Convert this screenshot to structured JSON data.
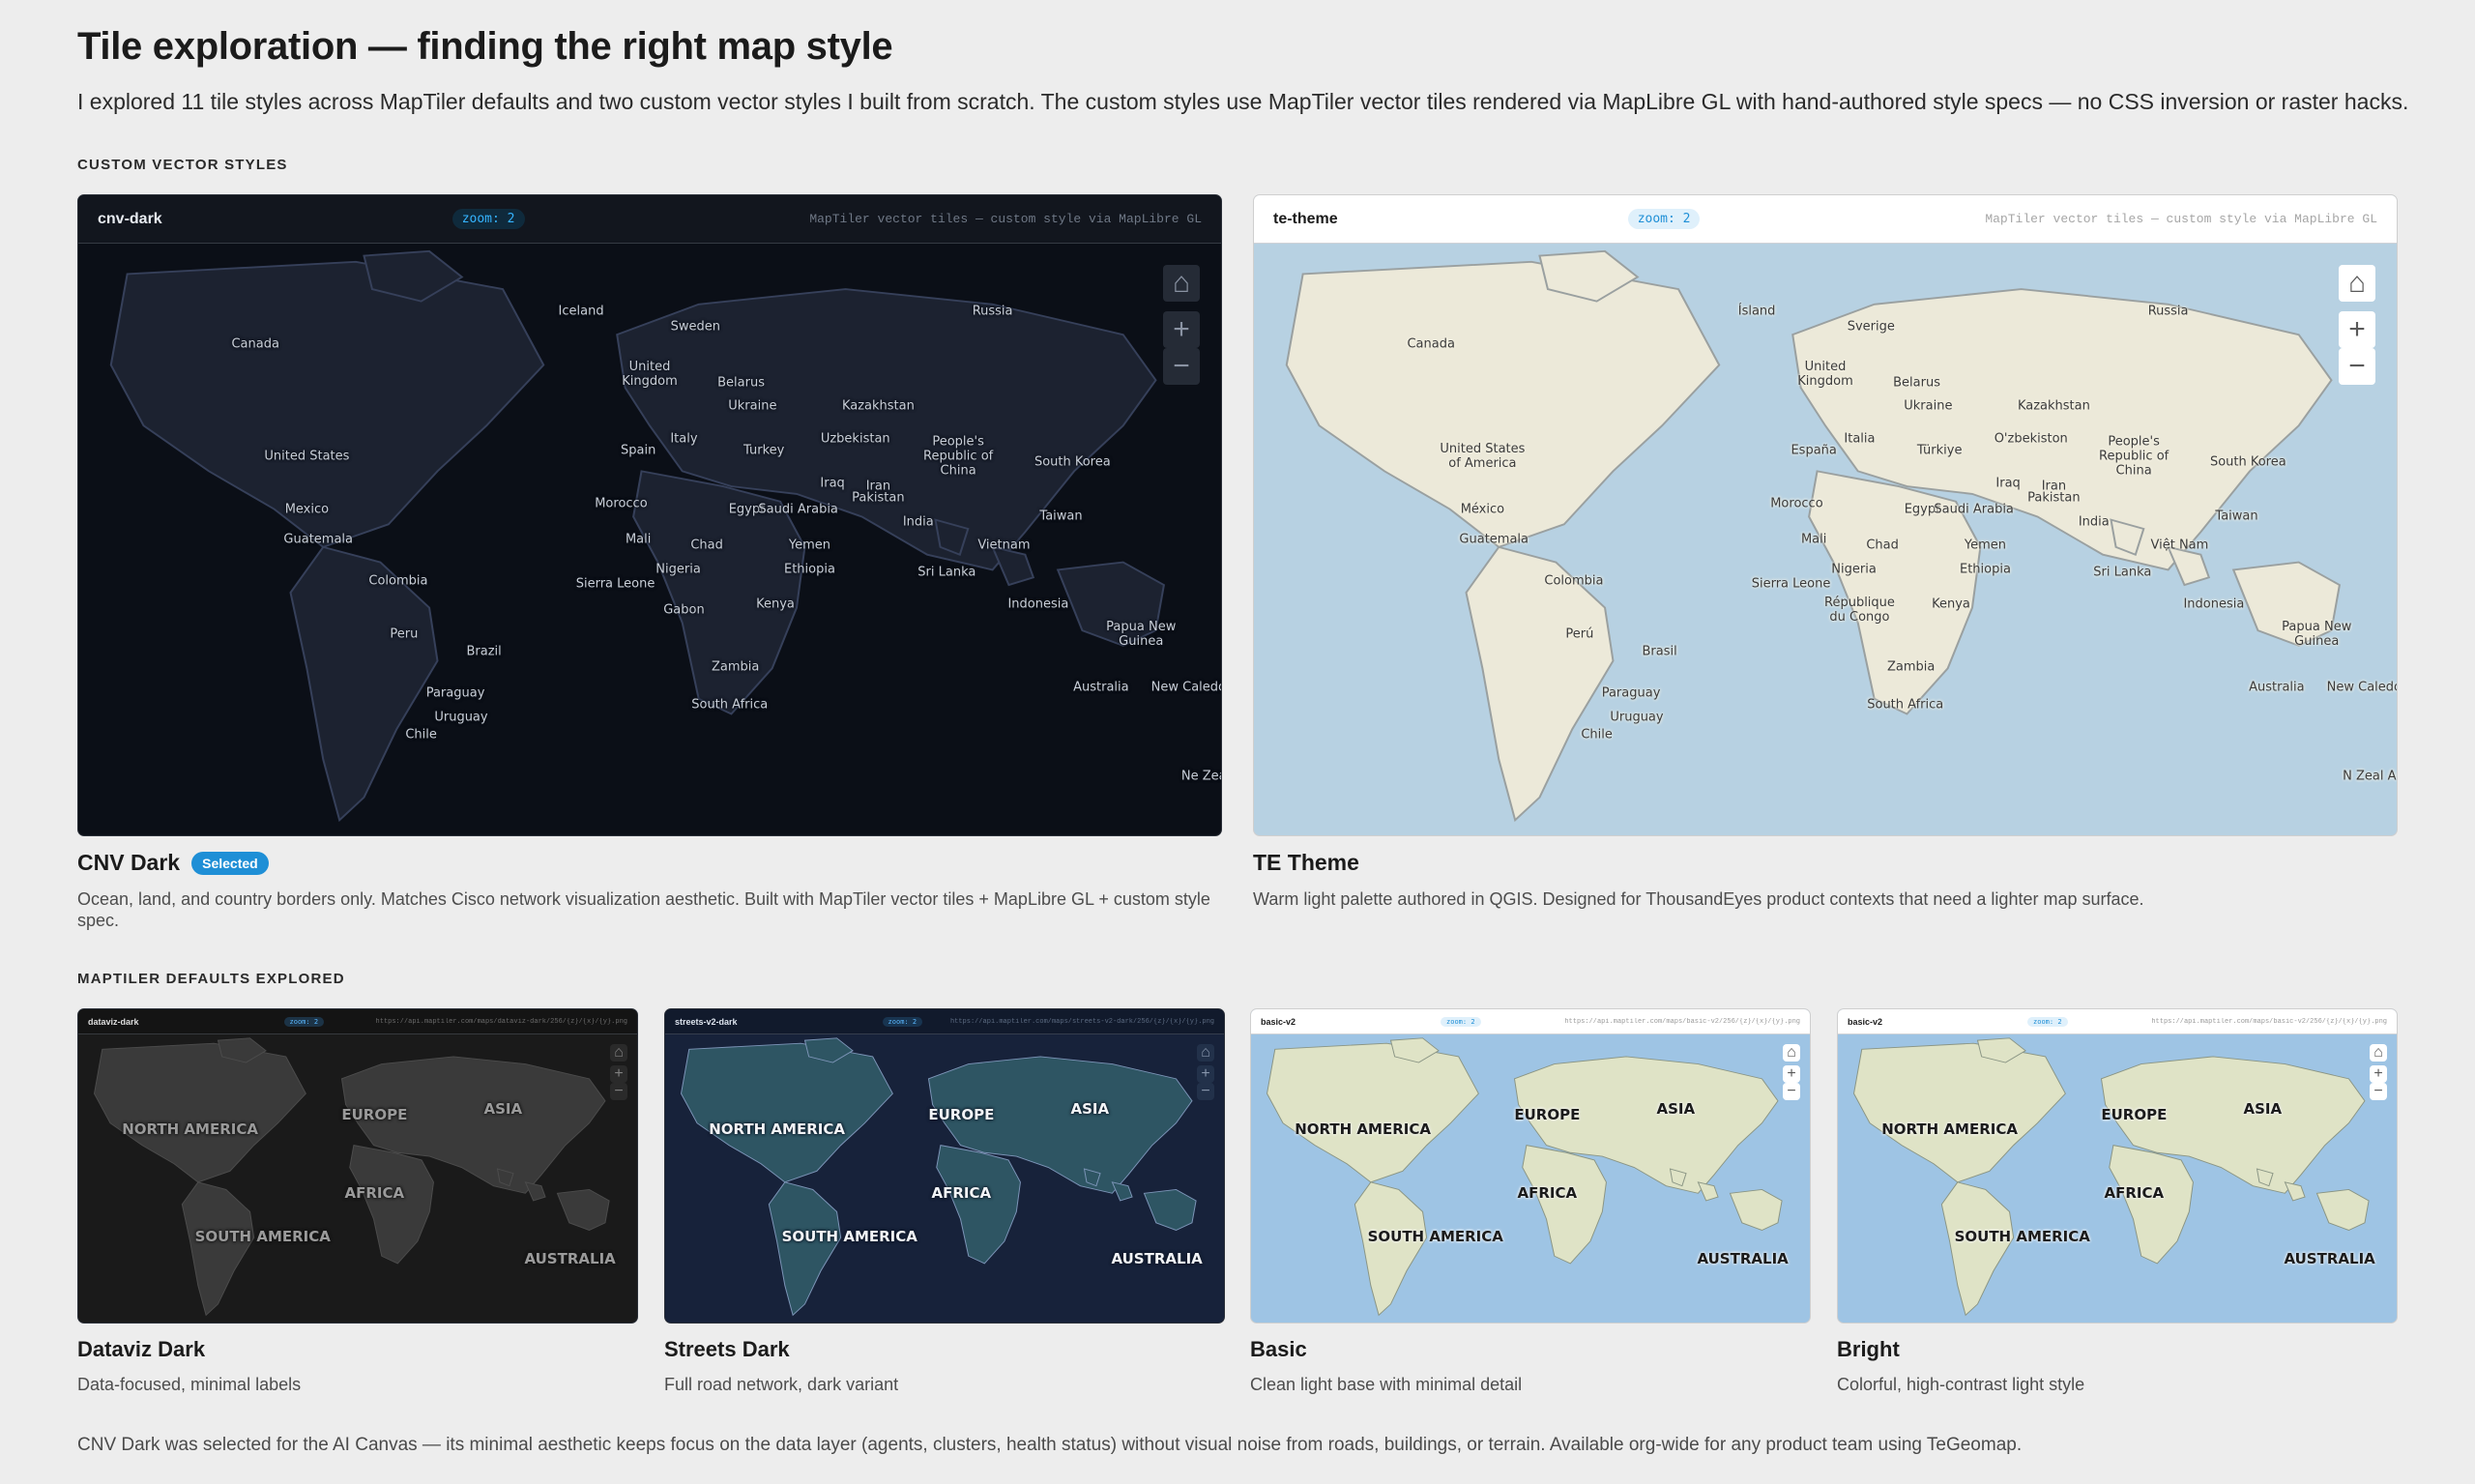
{
  "page": {
    "title": "Tile exploration — finding the right map style",
    "description": "I explored 11 tile styles across MapTiler defaults and two custom vector styles I built from scratch. The custom styles use MapTiler vector tiles rendered via MapLibre GL with hand-authored style specs — no CSS inversion or raster hacks.",
    "footer": "CNV Dark was selected for the AI Canvas — its minimal aesthetic keeps focus on the data layer (agents, clusters, health status) without visual noise from roads, buildings, or terrain. Available org-wide for any product team using TeGeomap."
  },
  "sections": {
    "custom": "CUSTOM VECTOR STYLES",
    "defaults": "MAPTILER DEFAULTS EXPLORED"
  },
  "custom_styles": [
    {
      "frame_name": "cnv-dark",
      "zoom": "zoom: 2",
      "source": "MapTiler vector tiles — custom style via MapLibre GL",
      "title": "CNV Dark",
      "badge": "Selected",
      "description": "Ocean, land, and country borders only. Matches Cisco network visualization aesthetic. Built with MapTiler vector tiles + MapLibre GL + custom style spec.",
      "labels": [
        "Canada",
        "Iceland",
        "Sweden",
        "Russia",
        "United Kingdom",
        "Belarus",
        "Ukraine",
        "Kazakhstan",
        "United States",
        "Spain",
        "Italy",
        "Turkey",
        "Uzbekistan",
        "People's Republic of China",
        "South Korea",
        "Iraq",
        "Iran",
        "Morocco",
        "Egypt",
        "Saudi Arabia",
        "Pakistan",
        "Mexico",
        "Guatemala",
        "Mali",
        "Chad",
        "Yemen",
        "India",
        "Taiwan",
        "Vietnam",
        "Sierra Leone",
        "Nigeria",
        "Ethiopia",
        "Sri Lanka",
        "Colombia",
        "Gabon",
        "Kenya",
        "Indonesia",
        "Papua New Guinea",
        "Peru",
        "Brazil",
        "Zambia",
        "Paraguay",
        "South Africa",
        "Australia",
        "New Caledon",
        "Uruguay",
        "Chile",
        "Ne Zea"
      ]
    },
    {
      "frame_name": "te-theme",
      "zoom": "zoom: 2",
      "source": "MapTiler vector tiles — custom style via MapLibre GL",
      "title": "TE Theme",
      "badge": "",
      "description": "Warm light palette authored in QGIS. Designed for ThousandEyes product contexts that need a lighter map surface.",
      "labels": [
        "Canada",
        "Ísland",
        "Sverige",
        "Russia",
        "United Kingdom",
        "Belarus",
        "Ukraine",
        "Kazakhstan",
        "United States of America",
        "España",
        "Italia",
        "Türkiye",
        "O'zbekiston",
        "People's Republic of China",
        "South Korea",
        "Iraq",
        "Iran",
        "Morocco",
        "Egypt",
        "Saudi Arabia",
        "Pakistan",
        "México",
        "Guatemala",
        "Mali",
        "Chad",
        "Yemen",
        "India",
        "Taiwan",
        "Việt Nam",
        "Sierra Leone",
        "Nigeria",
        "Ethiopia",
        "Sri Lanka",
        "Colombia",
        "République du Congo",
        "Kenya",
        "Indonesia",
        "Papua New Guinea",
        "Perú",
        "Brasil",
        "Zambia",
        "Paraguay",
        "South Africa",
        "Australia",
        "New Caledon",
        "Uruguay",
        "Chile",
        "N Zeal Aote"
      ]
    }
  ],
  "default_styles": [
    {
      "frame_name": "dataviz-dark",
      "zoom": "zoom: 2",
      "source": "https://api.maptiler.com/maps/dataviz-dark/256/{z}/{x}/{y}.png",
      "title": "Dataviz Dark",
      "description": "Data-focused, minimal labels",
      "labels": [
        "NORTH AMERICA",
        "EUROPE",
        "ASIA",
        "AFRICA",
        "SOUTH AMERICA",
        "AUSTRALIA"
      ]
    },
    {
      "frame_name": "streets-v2-dark",
      "zoom": "zoom: 2",
      "source": "https://api.maptiler.com/maps/streets-v2-dark/256/{z}/{x}/{y}.png",
      "title": "Streets Dark",
      "description": "Full road network, dark variant",
      "labels": [
        "NORTH AMERICA",
        "EUROPE",
        "ASIA",
        "AFRICA",
        "SOUTH AMERICA",
        "AUSTRALIA"
      ]
    },
    {
      "frame_name": "basic-v2",
      "zoom": "zoom: 2",
      "source": "https://api.maptiler.com/maps/basic-v2/256/{z}/{x}/{y}.png",
      "title": "Basic",
      "description": "Clean light base with minimal detail",
      "labels": [
        "NORTH AMERICA",
        "EUROPE",
        "ASIA",
        "AFRICA",
        "SOUTH AMERICA",
        "AUSTRALIA"
      ]
    },
    {
      "frame_name": "basic-v2",
      "zoom": "zoom: 2",
      "source": "https://api.maptiler.com/maps/basic-v2/256/{z}/{x}/{y}.png",
      "title": "Bright",
      "description": "Colorful, high-contrast light style",
      "labels": [
        "NORTH AMERICA",
        "EUROPE",
        "ASIA",
        "AFRICA",
        "SOUTH AMERICA",
        "AUSTRALIA"
      ]
    }
  ],
  "icons": {
    "home": "home-icon",
    "zoom_in": "zoom-in-icon",
    "zoom_out": "zoom-out-icon"
  },
  "colors": {
    "accent": "#1f8fd6",
    "cnv_ocean": "#0b0f17",
    "cnv_land": "#1c2230",
    "te_ocean": "#b7d1e2",
    "te_land": "#ece9d9",
    "dataviz_ocean": "#1a1a1a",
    "dataviz_land": "#3a3a3a",
    "streets_ocean": "#17223a",
    "streets_land": "#2e5563",
    "basic_ocean": "#9ec4e4",
    "basic_land": "#dfe3c6"
  }
}
